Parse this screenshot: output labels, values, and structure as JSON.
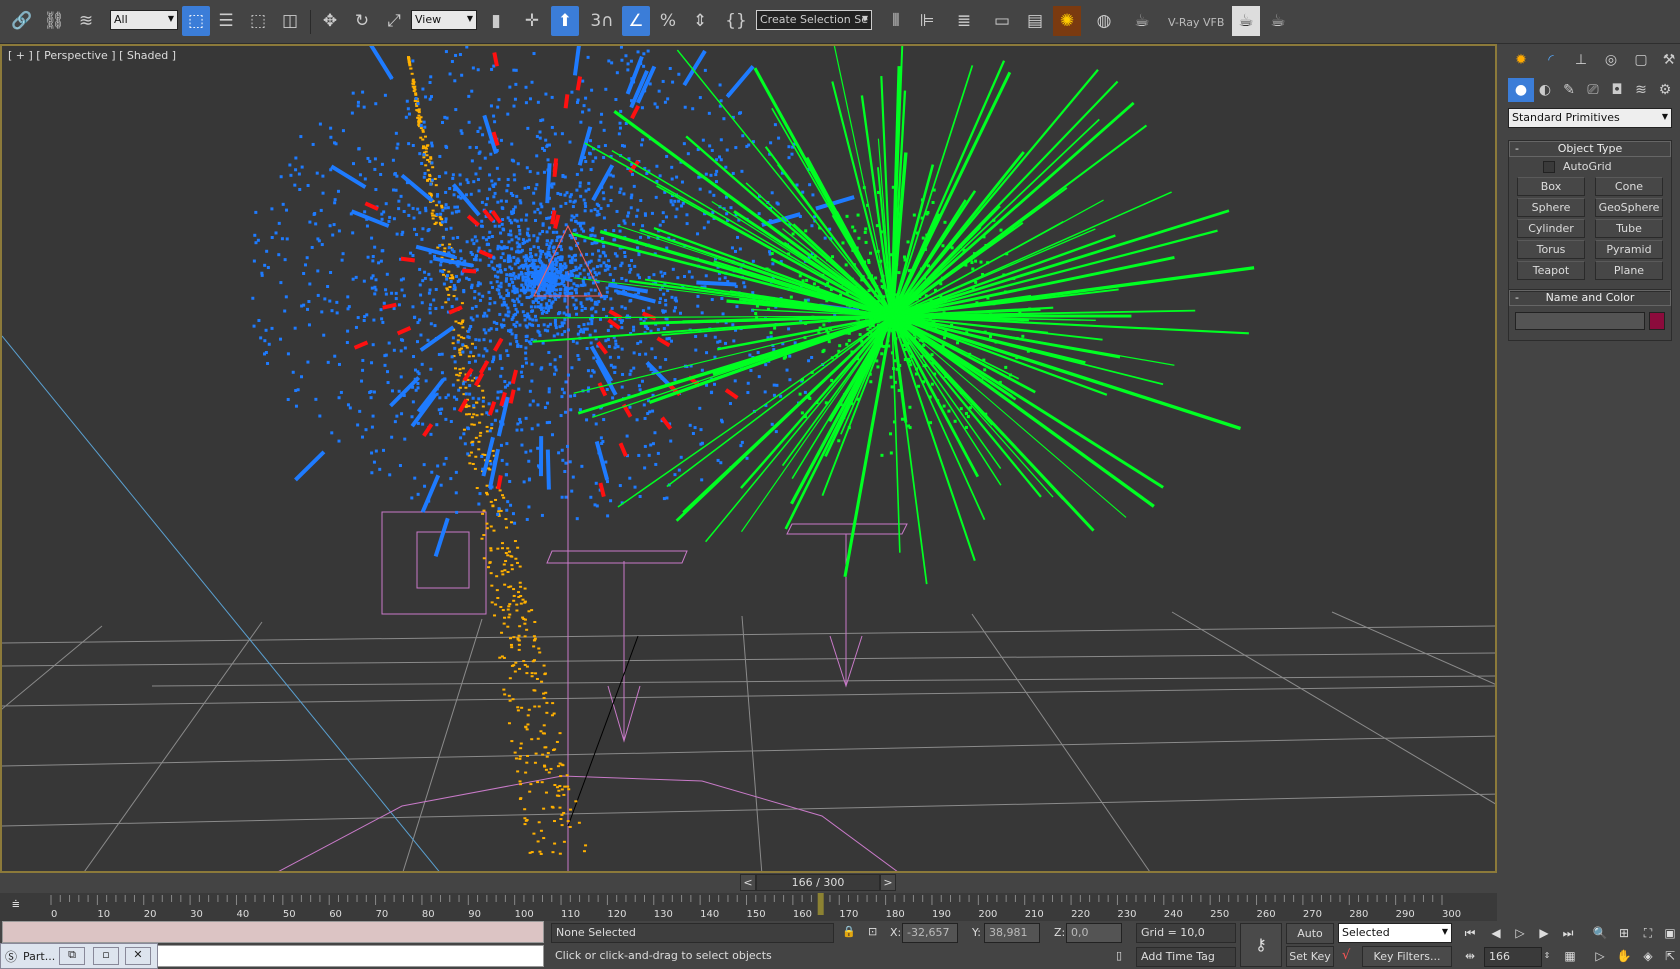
{
  "toolbar": {
    "selection_filter": "All",
    "ref_coord": "View",
    "selection_set": "Create Selection Se",
    "snap_label": "3",
    "vray_label": "V-Ray VFB",
    "icons": [
      "select-link-icon",
      "unlink-icon",
      "bind-spacewarp-icon",
      "select-object-icon",
      "select-by-name-icon",
      "rect-region-icon",
      "window-crossing-icon",
      "move-icon",
      "rotate-icon",
      "scale-icon",
      "pivot-icon",
      "manipulate-icon",
      "keyboard-shortcut-icon",
      "snap-icon",
      "angle-snap-icon",
      "percent-snap-icon",
      "spinner-snap-icon",
      "edit-named-sets-icon",
      "mirror-icon",
      "align-icon",
      "layer-icon",
      "scene-explorer-icon",
      "curve-editor-icon",
      "material-editor-icon",
      "render-setup-icon",
      "rendered-frame-icon",
      "render-icon"
    ]
  },
  "viewport": {
    "label": "[ + ] [ Perspective ] [ Shaded ]",
    "colors": {
      "blue": "#1e7bff",
      "green": "#00ff22",
      "red": "#ff1010",
      "orange": "#ffb000",
      "grid": "#8a8a8a",
      "helper": "#c87ac8"
    }
  },
  "command_panel": {
    "tabs": [
      "create-icon",
      "modify-icon",
      "hierarchy-icon",
      "motion-icon",
      "display-icon",
      "utilities-icon"
    ],
    "subtabs": [
      "geometry-icon",
      "shapes-icon",
      "lights-icon",
      "cameras-icon",
      "helpers-icon",
      "spacewarps-icon",
      "systems-icon"
    ],
    "category": "Standard Primitives",
    "object_type": {
      "title": "Object Type",
      "autogrid": "AutoGrid",
      "autogrid_checked": false,
      "buttons": [
        "Box",
        "Cone",
        "Sphere",
        "GeoSphere",
        "Cylinder",
        "Tube",
        "Torus",
        "Pyramid",
        "Teapot",
        "Plane"
      ]
    },
    "name_color": {
      "title": "Name and Color",
      "name": "",
      "color": "#8c0b3c"
    }
  },
  "timeline": {
    "frame_display": "166 / 300",
    "prev": "<",
    "next": ">",
    "current": 166,
    "end": 300,
    "ticks": [
      "0",
      "10",
      "20",
      "30",
      "40",
      "50",
      "60",
      "70",
      "80",
      "90",
      "100",
      "110",
      "120",
      "130",
      "140",
      "150",
      "160",
      "170",
      "180",
      "190",
      "200",
      "210",
      "220",
      "230",
      "240",
      "250",
      "260",
      "270",
      "280",
      "290",
      "300"
    ]
  },
  "status": {
    "taskbar_label": "Part...",
    "selection": "None Selected",
    "prompt": "Click or click-and-drag to select objects",
    "x_label": "X:",
    "x": "-32,657",
    "y_label": "Y:",
    "y": "38,981",
    "z_label": "Z:",
    "z": "0,0",
    "grid": "Grid = 10,0",
    "add_time_tag": "Add Time Tag",
    "auto_key": "Auto Key",
    "set_key": "Set Key",
    "key_mode": "Selected",
    "key_filters": "Key Filters...",
    "frame": "166"
  }
}
